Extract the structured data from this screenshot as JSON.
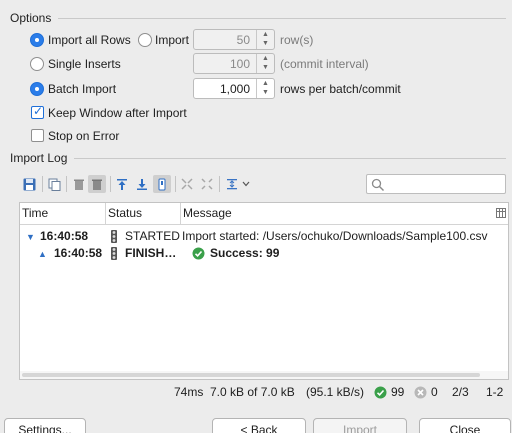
{
  "options": {
    "title": "Options",
    "import_all_rows": "Import all Rows",
    "import_label": "Import",
    "import_value": "50",
    "import_unit": "row(s)",
    "single_inserts": "Single Inserts",
    "single_value": "100",
    "single_unit": "(commit interval)",
    "batch_import": "Batch Import",
    "batch_value": "1,000",
    "batch_unit": "rows per batch/commit",
    "keep_window": "Keep Window after Import",
    "stop_on_error": "Stop on Error"
  },
  "log": {
    "title": "Import Log",
    "columns": [
      "Time",
      "Status",
      "Message"
    ],
    "rows": [
      {
        "time": "16:40:58",
        "status": "STARTED",
        "message": "Import started: /Users/ochuko/Downloads/Sample100.csv"
      },
      {
        "time": "16:40:58",
        "status": "FINISH…",
        "message": "Success: 99"
      }
    ]
  },
  "statusbar": {
    "elapsed": "74ms",
    "progress": "7.0 kB of 7.0 kB",
    "rate": "(95.1 kB/s)",
    "success_count": "99",
    "error_count": "0",
    "step": "2/3",
    "range": "1-2"
  },
  "buttons": {
    "settings": "Settings...",
    "back": "< Back",
    "import": "Import",
    "close": "Close"
  },
  "colors": {
    "accent": "#2b7de9",
    "success": "#3aa04a",
    "error_icon": "#b8b8b8"
  }
}
